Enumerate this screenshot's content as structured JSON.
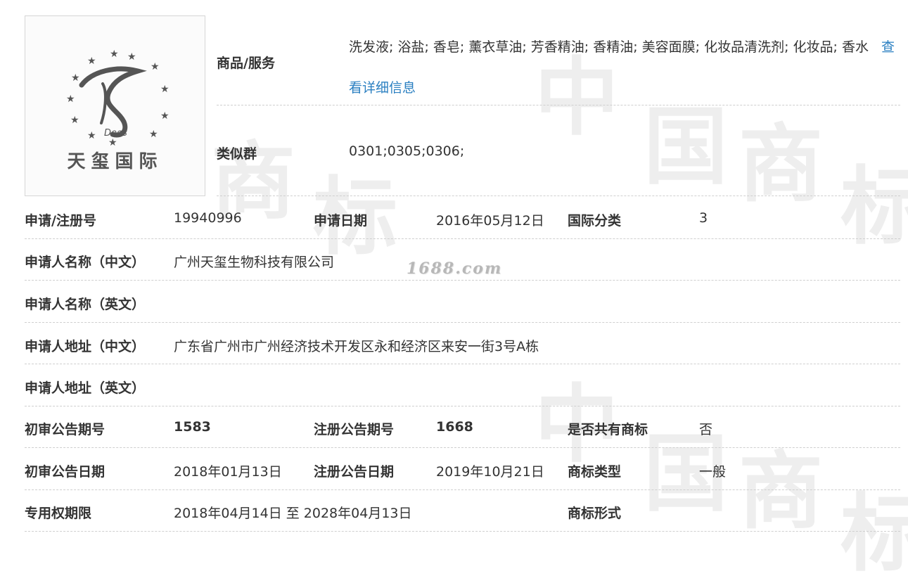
{
  "logo": {
    "text": "天玺国际",
    "signature": "Dees"
  },
  "watermark": {
    "site": "1688.com",
    "chars": [
      "中",
      "国",
      "商",
      "标",
      "商",
      "标",
      "中",
      "国",
      "商",
      "标"
    ]
  },
  "goods": {
    "label": "商品/服务",
    "value": "洗发液; 浴盐; 香皂; 薰衣草油; 芳香精油; 香精油; 美容面膜; 化妆品清洗剂; 化妆品; 香水",
    "link": "查看详细信息"
  },
  "similar_group": {
    "label": "类似群",
    "value": "0301;0305;0306;"
  },
  "rows": {
    "reg_no": {
      "label": "申请/注册号",
      "value": "19940996"
    },
    "apply_date": {
      "label": "申请日期",
      "value": "2016年05月12日"
    },
    "intl_class": {
      "label": "国际分类",
      "value": "3"
    },
    "applicant_cn": {
      "label": "申请人名称（中文）",
      "value": "广州天玺生物科技有限公司"
    },
    "applicant_en": {
      "label": "申请人名称（英文）",
      "value": ""
    },
    "address_cn": {
      "label": "申请人地址（中文）",
      "value": "广东省广州市广州经济技术开发区永和经济区来安一街3号A栋"
    },
    "address_en": {
      "label": "申请人地址（英文）",
      "value": ""
    },
    "prelim_issue": {
      "label": "初审公告期号",
      "value": "1583"
    },
    "reg_issue": {
      "label": "注册公告期号",
      "value": "1668"
    },
    "shared": {
      "label": "是否共有商标",
      "value": "否"
    },
    "prelim_date": {
      "label": "初审公告日期",
      "value": "2018年01月13日"
    },
    "reg_date": {
      "label": "注册公告日期",
      "value": "2019年10月21日"
    },
    "tm_type": {
      "label": "商标类型",
      "value": "一般"
    },
    "exclusive_period": {
      "label": "专用权期限",
      "value": "2018年04月14日 至 2028年04月13日"
    },
    "tm_form": {
      "label": "商标形式",
      "value": ""
    }
  }
}
